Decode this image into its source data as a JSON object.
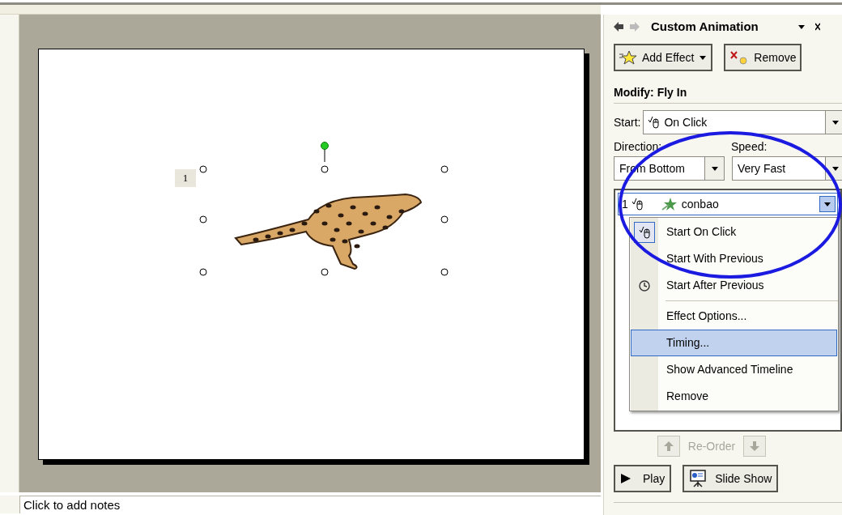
{
  "slide": {
    "animation_tag": "1"
  },
  "notes": {
    "placeholder": "Click to add notes"
  },
  "task_pane": {
    "title": "Custom Animation",
    "buttons": [
      {
        "kind": "add",
        "label": "Add Effect"
      },
      {
        "kind": "remove",
        "label": "Remove"
      }
    ],
    "modify_heading": "Modify: Fly In",
    "start": {
      "label": "Start:",
      "value": "On Click"
    },
    "direction": {
      "label": "Direction:",
      "value": "From Bottom"
    },
    "speed": {
      "label": "Speed:",
      "value": "Very Fast"
    },
    "effects": [
      {
        "number": "1",
        "name": "conbao",
        "selected": true
      }
    ],
    "context_menu": [
      {
        "kind": "mouse",
        "label": "Start On Click",
        "checked": true,
        "selected": false
      },
      {
        "kind": "plain",
        "label": "Start With Previous",
        "checked": false,
        "selected": false
      },
      {
        "kind": "clock",
        "label": "Start After Previous",
        "checked": false,
        "selected": false
      },
      {
        "kind": "separator"
      },
      {
        "kind": "plain",
        "label": "Effect Options...",
        "checked": false,
        "selected": false
      },
      {
        "kind": "plain",
        "label": "Timing...",
        "checked": false,
        "selected": true
      },
      {
        "kind": "plain",
        "label": "Show Advanced Timeline",
        "checked": false,
        "selected": false
      },
      {
        "kind": "plain",
        "label": "Remove",
        "checked": false,
        "selected": false
      }
    ],
    "reorder": {
      "label": "Re-Order",
      "disabled": true
    },
    "footer_buttons": [
      {
        "kind": "play",
        "label": "Play"
      },
      {
        "kind": "slideshow",
        "label": "Slide Show"
      }
    ]
  }
}
